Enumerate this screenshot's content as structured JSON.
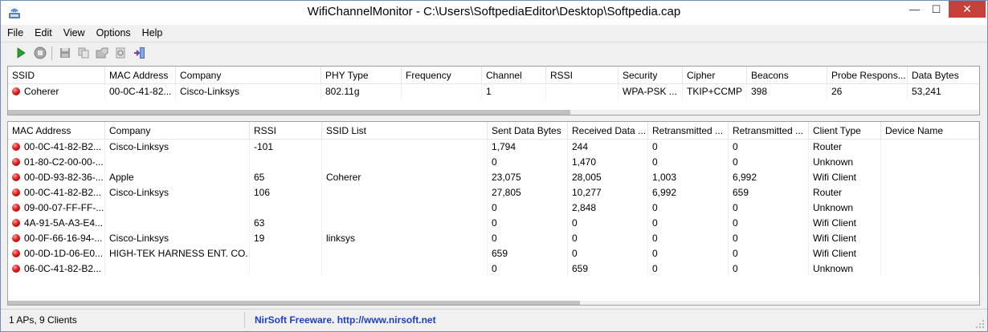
{
  "window": {
    "title": "WifiChannelMonitor  -  C:\\Users\\SoftpediaEditor\\Desktop\\Softpedia.cap",
    "minimize_glyph": "—",
    "maximize_glyph": "☐",
    "close_glyph": "✕"
  },
  "menu": {
    "items": [
      "File",
      "Edit",
      "View",
      "Options",
      "Help"
    ]
  },
  "toolbar": {
    "icons": [
      "start-capture-icon",
      "stop-capture-icon",
      "save-icon",
      "copy-icon",
      "properties-icon",
      "refresh-icon",
      "exit-icon"
    ]
  },
  "ap_table": {
    "columns": [
      "SSID",
      "MAC Address",
      "Company",
      "PHY Type",
      "Frequency",
      "Channel",
      "RSSI",
      "Security",
      "Cipher",
      "Beacons",
      "Probe Respons...",
      "Data Bytes"
    ],
    "rows": [
      [
        "Coherer",
        "00-0C-41-82...",
        "Cisco-Linksys",
        "802.11g",
        "",
        "1",
        "",
        "WPA-PSK ...",
        "TKIP+CCMP",
        "398",
        "26",
        "53,241"
      ]
    ]
  },
  "client_table": {
    "columns": [
      "MAC Address",
      "Company",
      "RSSI",
      "SSID List",
      "Sent Data Bytes",
      "Received Data ...",
      "Retransmitted ...",
      "Retransmitted ...",
      "Client Type",
      "Device Name"
    ],
    "rows": [
      [
        "00-0C-41-82-B2...",
        "Cisco-Linksys",
        "-101",
        "",
        "1,794",
        "244",
        "0",
        "0",
        "Router",
        ""
      ],
      [
        "01-80-C2-00-00-...",
        "",
        "",
        "",
        "0",
        "1,470",
        "0",
        "0",
        "Unknown",
        ""
      ],
      [
        "00-0D-93-82-36-...",
        "Apple",
        "65",
        "Coherer",
        "23,075",
        "28,005",
        "1,003",
        "6,992",
        "Wifi Client",
        ""
      ],
      [
        "00-0C-41-82-B2...",
        "Cisco-Linksys",
        "106",
        "",
        "27,805",
        "10,277",
        "6,992",
        "659",
        "Router",
        ""
      ],
      [
        "09-00-07-FF-FF-...",
        "",
        "",
        "",
        "0",
        "2,848",
        "0",
        "0",
        "Unknown",
        ""
      ],
      [
        "4A-91-5A-A3-E4...",
        "",
        "63",
        "",
        "0",
        "0",
        "0",
        "0",
        "Wifi Client",
        ""
      ],
      [
        "00-0F-66-16-94-...",
        "Cisco-Linksys",
        "19",
        "linksys",
        "0",
        "0",
        "0",
        "0",
        "Wifi Client",
        ""
      ],
      [
        "00-0D-1D-06-E0...",
        "HIGH-TEK HARNESS ENT. CO....",
        "",
        "",
        "659",
        "0",
        "0",
        "0",
        "Wifi Client",
        ""
      ],
      [
        "06-0C-41-82-B2...",
        "",
        "",
        "",
        "0",
        "659",
        "0",
        "0",
        "Unknown",
        ""
      ]
    ]
  },
  "status": {
    "summary": "1 APs, 9 Clients",
    "credit": "NirSoft Freeware.  http://www.nirsoft.net"
  },
  "colors": {
    "status_dot": "#e02020",
    "credit_link": "#1f3fbf",
    "close_button": "#c7413b"
  }
}
